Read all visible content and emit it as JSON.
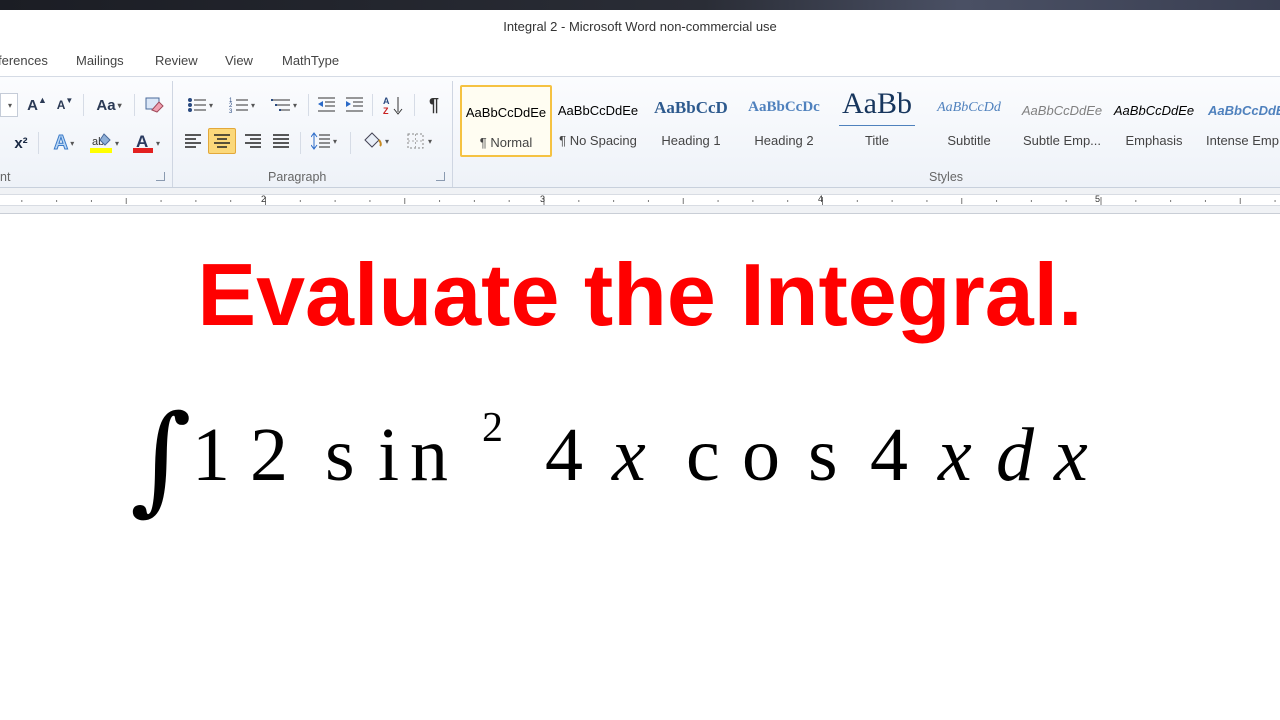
{
  "window": {
    "title": "Integral 2  -  Microsoft Word non-commercial use"
  },
  "tabs": [
    "ferences",
    "Mailings",
    "Review",
    "View",
    "MathType"
  ],
  "ribbon": {
    "groups": {
      "font": "nt",
      "paragraph": "Paragraph",
      "styles": "Styles"
    },
    "font_buttons": {
      "grow": "A",
      "shrink": "A",
      "case": "Aa",
      "superscript": "x²"
    }
  },
  "styles": [
    {
      "sample": "AaBbCcDdEe",
      "name": "¶ Normal"
    },
    {
      "sample": "AaBbCcDdEe",
      "name": "¶ No Spacing"
    },
    {
      "sample": "AaBbCcD",
      "name": "Heading 1"
    },
    {
      "sample": "AaBbCcDc",
      "name": "Heading 2"
    },
    {
      "sample": "AaBb",
      "name": "Title"
    },
    {
      "sample": "AaBbCcDd",
      "name": "Subtitle"
    },
    {
      "sample": "AaBbCcDdEe",
      "name": "Subtle Emp..."
    },
    {
      "sample": "AaBbCcDdEe",
      "name": "Emphasis"
    },
    {
      "sample": "AaBbCcDdE",
      "name": "Intense Emp"
    }
  ],
  "ruler": {
    "marks": [
      "2",
      "3",
      "4",
      "5"
    ]
  },
  "document": {
    "heading": "Evaluate the Integral.",
    "equation": {
      "integral": "∫",
      "tokens": [
        "1",
        "2",
        "s",
        "i",
        "n",
        "4",
        "x",
        "c",
        "o",
        "s",
        "4",
        "x",
        "d",
        "x"
      ],
      "superscript": "2"
    }
  },
  "colors": {
    "heading": "#ff0000",
    "selected_style_border": "#f5c242",
    "active_button": "#fbd87a"
  }
}
